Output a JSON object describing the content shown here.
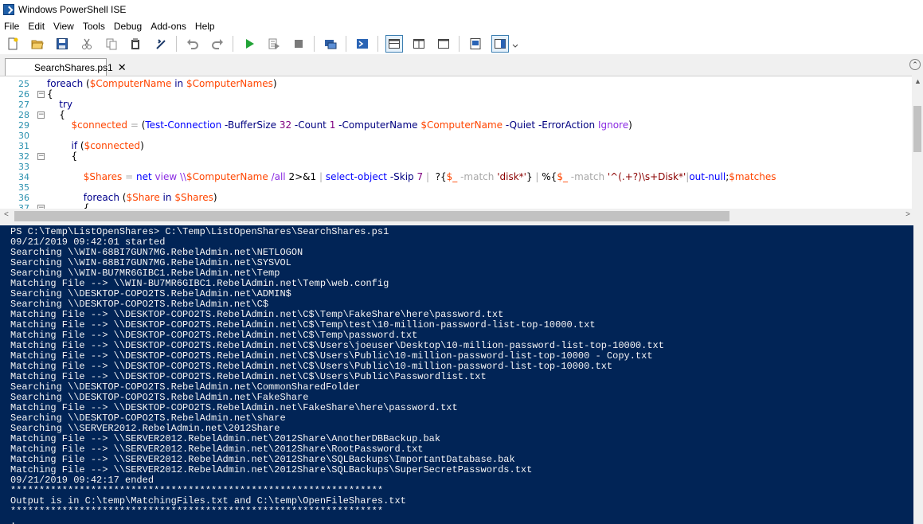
{
  "window": {
    "title": "Windows PowerShell ISE"
  },
  "menu": [
    "File",
    "Edit",
    "View",
    "Tools",
    "Debug",
    "Add-ons",
    "Help"
  ],
  "toolbar": {
    "icons": [
      "new-file-icon",
      "open-folder-icon",
      "save-icon",
      "cut-icon",
      "copy-icon",
      "paste-icon",
      "clear-icon",
      "undo-icon",
      "redo-icon",
      "run-icon",
      "run-selection-icon",
      "stop-icon",
      "remote-powershell-icon",
      "powershell-console-icon",
      "show-script-top-icon",
      "show-script-right-icon",
      "show-script-max-icon",
      "show-command-window-icon",
      "show-command-addon-icon",
      "toolbar-overflow-icon"
    ]
  },
  "tab": {
    "label": "SearchShares.ps1",
    "close": "✕"
  },
  "editor": {
    "lines": [
      {
        "num": "25",
        "fold": "",
        "tokens": [
          [
            "kw",
            "foreach "
          ],
          [
            "plain",
            "("
          ],
          [
            "var",
            "$ComputerName"
          ],
          [
            "kw",
            " in "
          ],
          [
            "var",
            "$ComputerNames"
          ],
          [
            "plain",
            ")"
          ]
        ]
      },
      {
        "num": "26",
        "fold": "−",
        "tokens": [
          [
            "plain",
            "{"
          ]
        ]
      },
      {
        "num": "27",
        "fold": "",
        "tokens": [
          [
            "plain",
            "    "
          ],
          [
            "kw",
            "try"
          ]
        ]
      },
      {
        "num": "28",
        "fold": "−",
        "tokens": [
          [
            "plain",
            "    {"
          ]
        ]
      },
      {
        "num": "29",
        "fold": "",
        "tokens": [
          [
            "plain",
            "        "
          ],
          [
            "var",
            "$connected"
          ],
          [
            "op",
            " = "
          ],
          [
            "plain",
            "("
          ],
          [
            "cmd",
            "Test-Connection"
          ],
          [
            "prm",
            " -BufferSize "
          ],
          [
            "num",
            "32"
          ],
          [
            "prm",
            " -Count "
          ],
          [
            "num",
            "1"
          ],
          [
            "prm",
            " -ComputerName "
          ],
          [
            "var",
            "$ComputerName"
          ],
          [
            "prm",
            " -Quiet"
          ],
          [
            "prm",
            " -ErrorAction "
          ],
          [
            "txt",
            "Ignore"
          ],
          [
            "plain",
            ")"
          ]
        ]
      },
      {
        "num": "30",
        "fold": "",
        "tokens": []
      },
      {
        "num": "31",
        "fold": "",
        "tokens": [
          [
            "plain",
            "        "
          ],
          [
            "kw",
            "if "
          ],
          [
            "plain",
            "("
          ],
          [
            "var",
            "$connected"
          ],
          [
            "plain",
            ")"
          ]
        ]
      },
      {
        "num": "32",
        "fold": "−",
        "tokens": [
          [
            "plain",
            "        {"
          ]
        ]
      },
      {
        "num": "33",
        "fold": "",
        "tokens": []
      },
      {
        "num": "34",
        "fold": "",
        "tokens": [
          [
            "plain",
            "            "
          ],
          [
            "var",
            "$Shares"
          ],
          [
            "op",
            " = "
          ],
          [
            "cmd",
            "net"
          ],
          [
            "txt",
            " view "
          ],
          [
            "txt",
            "\\\\"
          ],
          [
            "var",
            "$ComputerName"
          ],
          [
            "txt",
            " /all "
          ],
          [
            "plain",
            "2>&1 "
          ],
          [
            "op",
            "| "
          ],
          [
            "cmd",
            "select-object"
          ],
          [
            "prm",
            " -Skip "
          ],
          [
            "num",
            "7"
          ],
          [
            "op",
            " |  "
          ],
          [
            "plain",
            "?{"
          ],
          [
            "var",
            "$_"
          ],
          [
            "op",
            " -match "
          ],
          [
            "str",
            "'disk*'"
          ],
          [
            "plain",
            "} "
          ],
          [
            "op",
            "| "
          ],
          [
            "plain",
            "%{"
          ],
          [
            "var",
            "$_"
          ],
          [
            "op",
            " -match "
          ],
          [
            "str",
            "'^(.+?)\\s+Disk*'"
          ],
          [
            "op",
            "|"
          ],
          [
            "cmd",
            "out-null"
          ],
          [
            "plain",
            ";"
          ],
          [
            "var",
            "$matches"
          ]
        ]
      },
      {
        "num": "35",
        "fold": "",
        "tokens": []
      },
      {
        "num": "36",
        "fold": "",
        "tokens": [
          [
            "plain",
            "            "
          ],
          [
            "kw",
            "foreach "
          ],
          [
            "plain",
            "("
          ],
          [
            "var",
            "$Share"
          ],
          [
            "kw",
            " in "
          ],
          [
            "var",
            "$Shares"
          ],
          [
            "plain",
            ")"
          ]
        ]
      },
      {
        "num": "37",
        "fold": "−",
        "tokens": [
          [
            "plain",
            "            {"
          ]
        ]
      }
    ]
  },
  "console": {
    "lines": [
      "PS C:\\Temp\\ListOpenShares> C:\\Temp\\ListOpenShares\\SearchShares.ps1",
      "09/21/2019 09:42:01 started",
      "Searching \\\\WIN-68BI7GUN7MG.RebelAdmin.net\\NETLOGON",
      "Searching \\\\WIN-68BI7GUN7MG.RebelAdmin.net\\SYSVOL",
      "Searching \\\\WIN-BU7MR6GIBC1.RebelAdmin.net\\Temp",
      "Matching File --> \\\\WIN-BU7MR6GIBC1.RebelAdmin.net\\Temp\\web.config",
      "Searching \\\\DESKTOP-COPO2TS.RebelAdmin.net\\ADMIN$",
      "Searching \\\\DESKTOP-COPO2TS.RebelAdmin.net\\C$",
      "Matching File --> \\\\DESKTOP-COPO2TS.RebelAdmin.net\\C$\\Temp\\FakeShare\\here\\password.txt",
      "Matching File --> \\\\DESKTOP-COPO2TS.RebelAdmin.net\\C$\\Temp\\test\\10-million-password-list-top-10000.txt",
      "Matching File --> \\\\DESKTOP-COPO2TS.RebelAdmin.net\\C$\\Temp\\password.txt",
      "Matching File --> \\\\DESKTOP-COPO2TS.RebelAdmin.net\\C$\\Users\\joeuser\\Desktop\\10-million-password-list-top-10000.txt",
      "Matching File --> \\\\DESKTOP-COPO2TS.RebelAdmin.net\\C$\\Users\\Public\\10-million-password-list-top-10000 - Copy.txt",
      "Matching File --> \\\\DESKTOP-COPO2TS.RebelAdmin.net\\C$\\Users\\Public\\10-million-password-list-top-10000.txt",
      "Matching File --> \\\\DESKTOP-COPO2TS.RebelAdmin.net\\C$\\Users\\Public\\Passwordlist.txt",
      "Searching \\\\DESKTOP-COPO2TS.RebelAdmin.net\\CommonSharedFolder",
      "Searching \\\\DESKTOP-COPO2TS.RebelAdmin.net\\FakeShare",
      "Matching File --> \\\\DESKTOP-COPO2TS.RebelAdmin.net\\FakeShare\\here\\password.txt",
      "Searching \\\\DESKTOP-COPO2TS.RebelAdmin.net\\share",
      "Searching \\\\SERVER2012.RebelAdmin.net\\2012Share",
      "Matching File --> \\\\SERVER2012.RebelAdmin.net\\2012Share\\AnotherDBBackup.bak",
      "Matching File --> \\\\SERVER2012.RebelAdmin.net\\2012Share\\RootPassword.txt",
      "Matching File --> \\\\SERVER2012.RebelAdmin.net\\2012Share\\SQLBackups\\ImportantDatabase.bak",
      "Matching File --> \\\\SERVER2012.RebelAdmin.net\\2012Share\\SQLBackups\\SuperSecretPasswords.txt",
      "09/21/2019 09:42:17 ended",
      "*****************************************************************",
      "Output is in C:\\temp\\MatchingFiles.txt and C:\\temp\\OpenFileShares.txt",
      "*****************************************************************",
      "."
    ]
  },
  "colors": {
    "console_bg": "#012456",
    "console_fg": "#f5f5f5",
    "line_number": "#2b91af"
  }
}
